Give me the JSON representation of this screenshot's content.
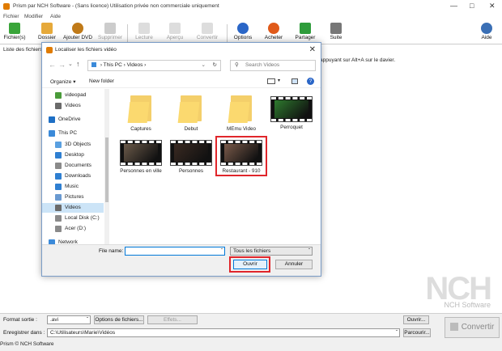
{
  "app": {
    "title": "Prism par NCH Software - (Sans licence) Utilisation privée non commerciale uniquement",
    "menu": [
      "Fichier",
      "Modifier",
      "Aide"
    ],
    "toolbar": [
      {
        "label": "Fichier(s)",
        "icon": "add-file-icon",
        "color": "#3aa53a",
        "enabled": true
      },
      {
        "label": "Dossier",
        "icon": "folder-icon",
        "color": "#e6a93a",
        "enabled": true
      },
      {
        "label": "Ajouter DVD",
        "icon": "dvd-icon",
        "color": "#c07a18",
        "enabled": true
      },
      {
        "label": "Supprimer",
        "icon": "remove-icon",
        "color": "#aaaaaa",
        "enabled": false
      },
      {
        "label": "Lecture",
        "icon": "play-icon",
        "color": "#bbbbbb",
        "enabled": false
      },
      {
        "label": "Aperçu",
        "icon": "preview-icon",
        "color": "#bbbbbb",
        "enabled": false
      },
      {
        "label": "Convertir",
        "icon": "convert-icon",
        "color": "#bbbbbb",
        "enabled": false
      },
      {
        "label": "Options",
        "icon": "options-icon",
        "color": "#2a66c7",
        "enabled": true
      },
      {
        "label": "Acheter",
        "icon": "buy-icon",
        "color": "#e05a1a",
        "enabled": true
      },
      {
        "label": "Partager",
        "icon": "share-icon",
        "color": "#2e9c3b",
        "enabled": true
      },
      {
        "label": "Suite",
        "icon": "suite-icon",
        "color": "#777777",
        "enabled": true
      },
      {
        "label": "Aide",
        "icon": "help-icon",
        "color": "#3a6fb5",
        "enabled": true
      }
    ],
    "list_header": "Liste des fichiers à",
    "hint_right": "appuyant sur Alt+A sur le davier.",
    "brand_logo": "NCH",
    "brand_sub": "NCH Software",
    "bottom": {
      "format_label": "Format sortie :",
      "format_value": ".avi",
      "options_btn": "Options de fichiers...",
      "effets_btn": "Effets...",
      "ouvrir_btn": "Ouvrir...",
      "save_label": "Enregistrer dans :",
      "save_path": "C:\\Utilisateurs\\Marie\\Vidéos",
      "parcourir_btn": "Parcourir...",
      "convertir_btn": "Convertir"
    },
    "status": "Prism © NCH Software"
  },
  "dialog": {
    "title": "Localiser les fichiers vidéo",
    "path": [
      "This PC",
      "Videos"
    ],
    "search_placeholder": "Search Videos",
    "organize": "Organize",
    "new_folder": "New folder",
    "nav": [
      {
        "label": "videopad",
        "icon": "videopad-icon",
        "color": "#4a9b3a"
      },
      {
        "label": "Videos",
        "icon": "videos-folder-icon",
        "color": "#6a6a6a"
      },
      {
        "label": "OneDrive",
        "icon": "onedrive-icon",
        "color": "#1e6fc5"
      },
      {
        "label": "This PC",
        "icon": "computer-icon",
        "color": "#3b8ad9"
      },
      {
        "label": "3D Objects",
        "icon": "3d-objects-icon",
        "color": "#5aa0e0"
      },
      {
        "label": "Desktop",
        "icon": "desktop-icon",
        "color": "#2f7fd1"
      },
      {
        "label": "Documents",
        "icon": "documents-icon",
        "color": "#8a8a8a"
      },
      {
        "label": "Downloads",
        "icon": "downloads-icon",
        "color": "#2f7fd1"
      },
      {
        "label": "Music",
        "icon": "music-icon",
        "color": "#2f7fd1"
      },
      {
        "label": "Pictures",
        "icon": "pictures-icon",
        "color": "#6a9ad1"
      },
      {
        "label": "Videos",
        "icon": "videos-icon",
        "color": "#6a6a6a",
        "selected": true
      },
      {
        "label": "Local Disk (C:)",
        "icon": "disk-icon",
        "color": "#8a8a8a"
      },
      {
        "label": "Acer (D:)",
        "icon": "disk-icon",
        "color": "#8a8a8a"
      },
      {
        "label": "Network",
        "icon": "network-icon",
        "color": "#3b8ad9"
      }
    ],
    "files": [
      {
        "label": "Captures",
        "type": "folder"
      },
      {
        "label": "Debut",
        "type": "folder"
      },
      {
        "label": "MEmu Video",
        "type": "folder"
      },
      {
        "label": "Perroquet",
        "type": "video",
        "color": "#2e7a2e"
      },
      {
        "label": "Personnes en ville",
        "type": "video",
        "color": "#6b5a4a"
      },
      {
        "label": "Personnes",
        "type": "video",
        "color": "#3a2a22"
      },
      {
        "label": "Restaurant - 910",
        "type": "video",
        "color": "#7a5a4a",
        "selected": true
      }
    ],
    "filename_label": "File name:",
    "filename_value": "",
    "filter": "Tous les fichiers",
    "open_btn": "Ouvrir",
    "cancel_btn": "Annuler"
  }
}
